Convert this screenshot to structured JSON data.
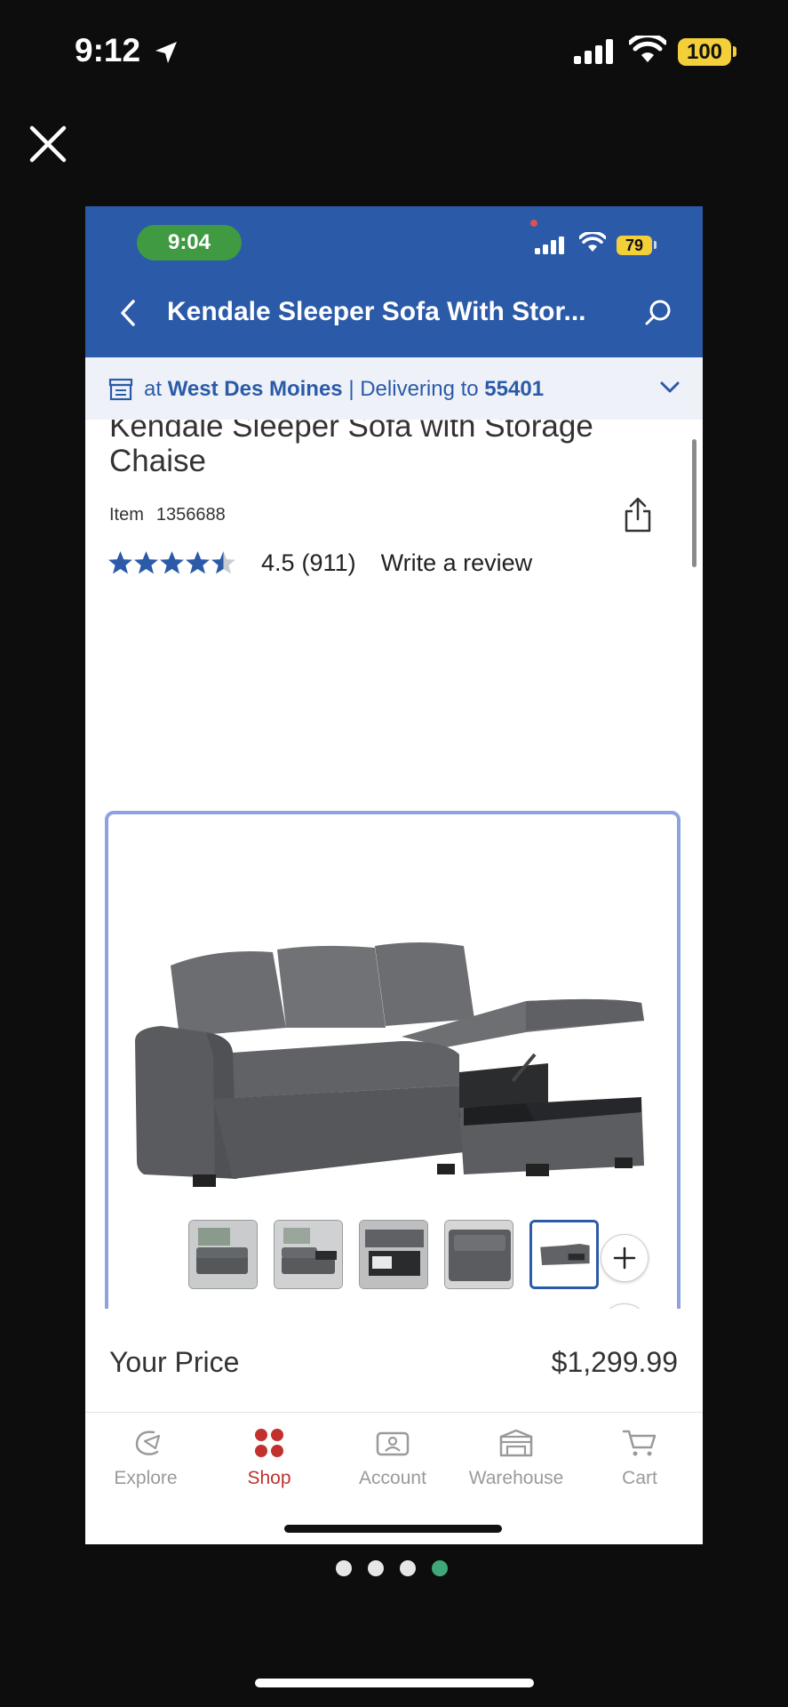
{
  "outer_status": {
    "time": "9:12",
    "battery": "100"
  },
  "inner_status": {
    "time": "9:04",
    "battery": "79"
  },
  "header": {
    "title": "Kendale Sleeper Sofa With Stor..."
  },
  "location_bar": {
    "prefix": "at",
    "store": "West Des Moines",
    "separator": "|",
    "delivering_label": "Delivering to",
    "zip": "55401"
  },
  "product": {
    "title": "Kendale Sleeper Sofa with Storage Chaise",
    "item_label": "Item",
    "item_number": "1356688",
    "rating_value": "4.5",
    "review_count": "(911)",
    "rating": 4.5,
    "write_review": "Write a review"
  },
  "price": {
    "label": "Your Price",
    "value": "$1,299.99"
  },
  "thumbnails": {
    "count": 5,
    "active_index": 4
  },
  "tabbar": {
    "items": [
      {
        "label": "Explore",
        "icon": "explore-icon"
      },
      {
        "label": "Shop",
        "icon": "shop-icon"
      },
      {
        "label": "Account",
        "icon": "account-icon"
      },
      {
        "label": "Warehouse",
        "icon": "warehouse-icon"
      },
      {
        "label": "Cart",
        "icon": "cart-icon"
      }
    ],
    "active": "Shop"
  },
  "pager": {
    "total": 4,
    "active_index": 3
  },
  "colors": {
    "header": "#2b5aa8",
    "accent_red": "#c0312f",
    "image_border": "#8ea1e0",
    "pager_active": "#3fa77a"
  }
}
